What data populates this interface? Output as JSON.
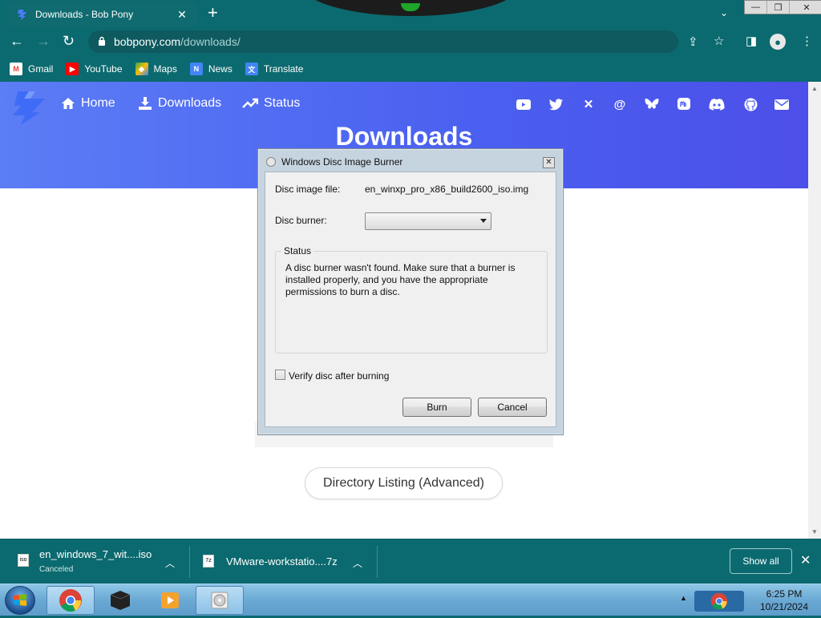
{
  "browser": {
    "tab_title": "Downloads - Bob Pony",
    "new_tab": "+",
    "url_host": "bobpony.com",
    "url_path": "/downloads/",
    "bookmarks": [
      {
        "label": "Gmail",
        "icon": "gmail-icon",
        "color": "#ea4335"
      },
      {
        "label": "YouTube",
        "icon": "youtube-icon",
        "color": "#ff0000"
      },
      {
        "label": "Maps",
        "icon": "maps-icon",
        "color": "#34a853"
      },
      {
        "label": "News",
        "icon": "news-icon",
        "color": "#4285f4"
      },
      {
        "label": "Translate",
        "icon": "translate-icon",
        "color": "#4285f4"
      }
    ]
  },
  "site": {
    "nav": {
      "home": "Home",
      "downloads": "Downloads",
      "status": "Status"
    },
    "social_icons": [
      "youtube-icon",
      "twitter-icon",
      "x-icon",
      "threads-icon",
      "bluesky-icon",
      "mastodon-icon",
      "discord-icon",
      "github-icon",
      "email-icon"
    ],
    "page_title": "Downloads",
    "directory_button": "Directory Listing (Advanced)",
    "accent": "#4a5ff0"
  },
  "dialog": {
    "title": "Windows Disc Image Burner",
    "disc_image_label": "Disc image file:",
    "disc_image_value": "en_winxp_pro_x86_build2600_iso.img",
    "burner_label": "Disc burner:",
    "burner_value": "",
    "status_legend": "Status",
    "status_text": "A disc burner wasn't found. Make sure that a burner is installed properly, and you have the appropriate permissions to burn a disc.",
    "verify_label": "Verify disc after burning",
    "verify_checked": false,
    "burn_button": "Burn",
    "cancel_button": "Cancel"
  },
  "downloads": {
    "items": [
      {
        "name": "en_windows_7_wit....iso",
        "status": "Canceled",
        "icon": "iso-file-icon"
      },
      {
        "name": "VMware-workstatio....7z",
        "status": "",
        "icon": "7z-file-icon"
      }
    ],
    "show_all": "Show all"
  },
  "taskbar": {
    "time": "6:25 PM",
    "date": "10/21/2024"
  }
}
